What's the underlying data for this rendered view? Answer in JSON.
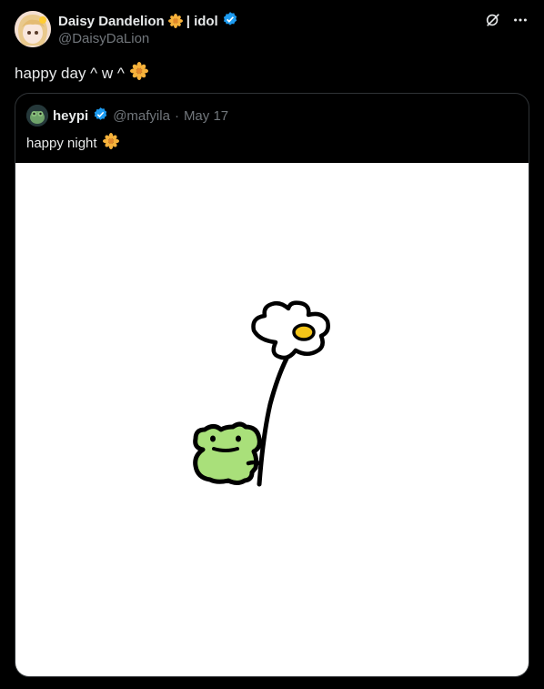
{
  "author": {
    "display_name": "Daisy Dandelion",
    "name_suffix": "| idol",
    "handle": "@DaisyDaLion",
    "verified": true
  },
  "post": {
    "text": "happy day ^ w ^"
  },
  "quote": {
    "author_name": "heypi",
    "author_handle": "@mafyila",
    "separator": "·",
    "date": "May 17",
    "verified": true,
    "text": "happy night",
    "media_description": "frog holding a daisy flower drawing"
  },
  "icons": {
    "top_action_1": "grok-icon",
    "top_action_2": "more-icon",
    "verified": "verified-badge-icon",
    "emoji": "daisy-emoji"
  },
  "colors": {
    "background": "#000000",
    "text": "#e7e9ea",
    "muted": "#71767b",
    "verified": "#1d9bf0",
    "border": "#2f3336"
  }
}
